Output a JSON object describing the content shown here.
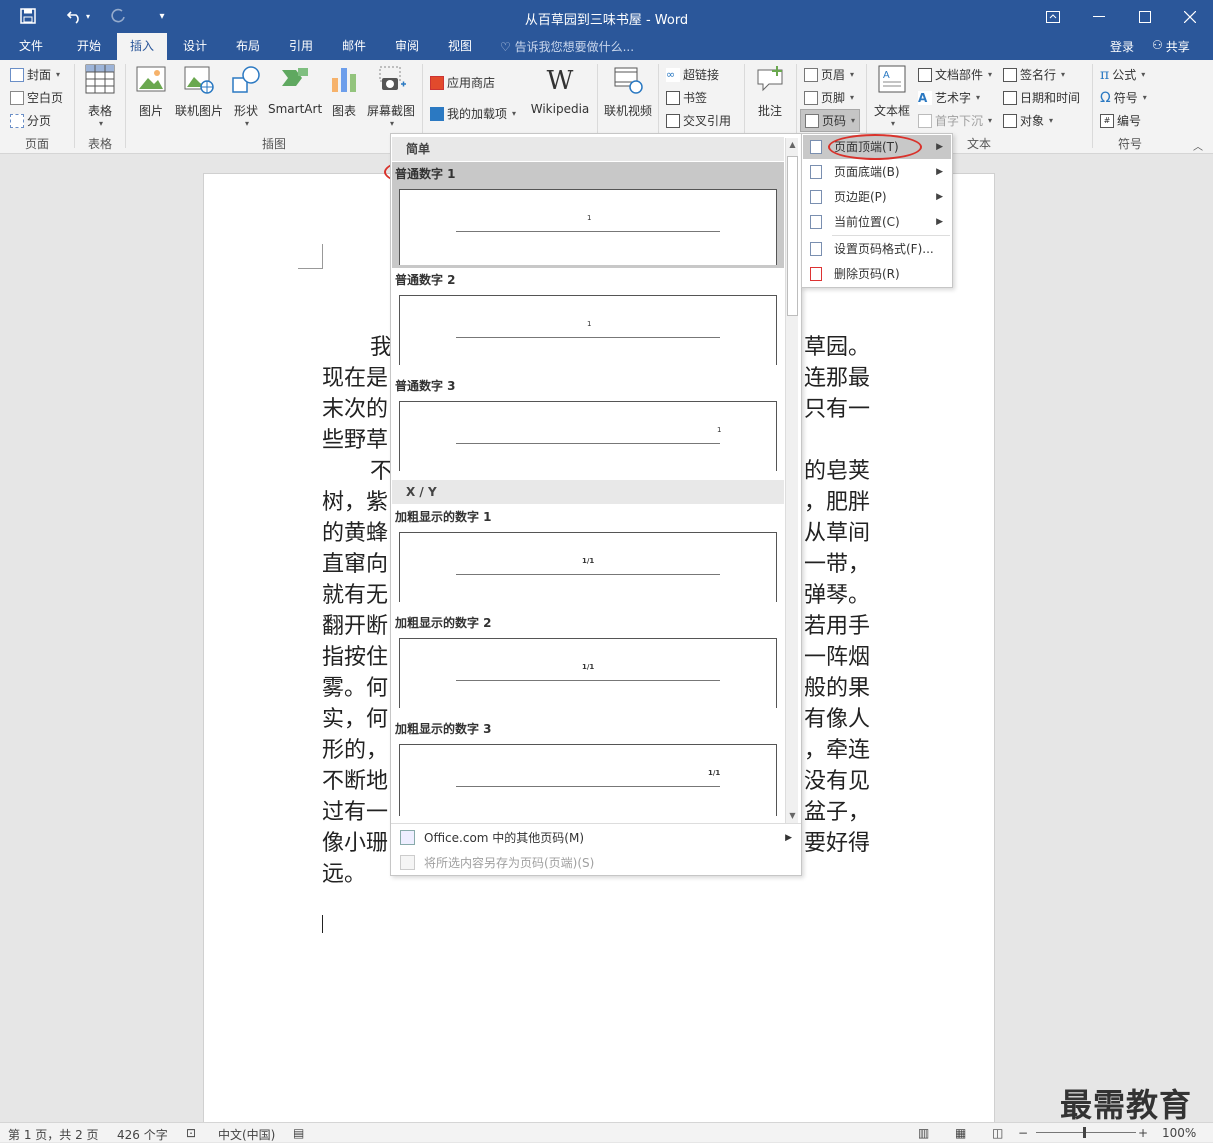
{
  "window": {
    "title": "从百草园到三味书屋 - Word"
  },
  "qat": {
    "save": "save-icon",
    "undo": "undo-icon",
    "redo": "redo-icon",
    "customize": "▾"
  },
  "tabs": [
    "文件",
    "开始",
    "插入",
    "设计",
    "布局",
    "引用",
    "邮件",
    "审阅",
    "视图"
  ],
  "active_tab": "插入",
  "tell_me": "告诉我您想要做什么...",
  "account": {
    "login": "登录",
    "share": "共享"
  },
  "ribbon": {
    "pages": {
      "label": "页面",
      "cover": "封面",
      "blank": "空白页",
      "break": "分页"
    },
    "tables": {
      "label": "表格",
      "table": "表格"
    },
    "illustrations": {
      "label": "插图",
      "picture": "图片",
      "online_picture": "联机图片",
      "shapes": "形状",
      "smartart": "SmartArt",
      "chart": "图表",
      "screenshot": "屏幕截图"
    },
    "addins": {
      "store": "应用商店",
      "my_addins": "我的加载项",
      "wikipedia": "Wikipedia"
    },
    "media": {
      "online_video": "联机视频"
    },
    "links": {
      "hyperlink": "超链接",
      "bookmark": "书签",
      "cross_ref": "交叉引用"
    },
    "comments": {
      "comment": "批注"
    },
    "header_footer": {
      "header": "页眉",
      "footer": "页脚",
      "page_number": "页码"
    },
    "text": {
      "label": "文本",
      "textbox": "文本框",
      "quick_parts": "文档部件",
      "wordart": "艺术字",
      "dropcap": "首字下沉",
      "signature": "签名行",
      "datetime": "日期和时间",
      "object": "对象"
    },
    "symbols": {
      "label": "符号",
      "equation": "公式",
      "symbol": "符号",
      "number": "编号"
    }
  },
  "document": {
    "lines": [
      {
        "text": "我",
        "indent": true
      },
      {
        "text": "现在是"
      },
      {
        "text": "末次的"
      },
      {
        "text": "些野草"
      },
      {
        "text": "不",
        "indent": true
      },
      {
        "text": "树，紫"
      },
      {
        "text": "的黄蜂"
      },
      {
        "text": "直窜向"
      },
      {
        "text": "就有无"
      },
      {
        "text": "翻开断"
      },
      {
        "text": "指按住"
      },
      {
        "text": "雾。何"
      },
      {
        "text": "实，何"
      },
      {
        "text": "形的，"
      },
      {
        "text": "不断地"
      },
      {
        "text": "过有一"
      },
      {
        "text": "像小珊"
      },
      {
        "text": "远。"
      }
    ],
    "right_lines": [
      "草园。",
      "连那最",
      "只有一",
      "",
      "的皂荚",
      "，肥胖",
      "从草间",
      "一带，",
      "弹琴。",
      "若用手",
      "一阵烟",
      "般的果",
      "有像人",
      "，牵连",
      "没有见",
      "盆子，",
      "要好得"
    ]
  },
  "gallery": {
    "section1": "简单",
    "items1": [
      {
        "label": "普通数字 1",
        "num": "1"
      },
      {
        "label": "普通数字 2",
        "num": "1"
      },
      {
        "label": "普通数字 3",
        "num": "1"
      }
    ],
    "section2": "X / Y",
    "items2": [
      {
        "label": "加粗显示的数字 1",
        "num": "1/1"
      },
      {
        "label": "加粗显示的数字 2",
        "num": "1/1"
      },
      {
        "label": "加粗显示的数字 3",
        "num": "1/1"
      }
    ],
    "more": "Office.com 中的其他页码(M)",
    "save_sel": "将所选内容另存为页码(页端)(S)"
  },
  "submenu": {
    "items": [
      "页面顶端(T)",
      "页面底端(B)",
      "页边距(P)",
      "当前位置(C)",
      "设置页码格式(F)...",
      "删除页码(R)"
    ]
  },
  "status": {
    "page": "第 1 页，共 2 页",
    "words": "426 个字",
    "lang": "中文(中国)",
    "zoom": "100%"
  },
  "watermark": "最需教育"
}
